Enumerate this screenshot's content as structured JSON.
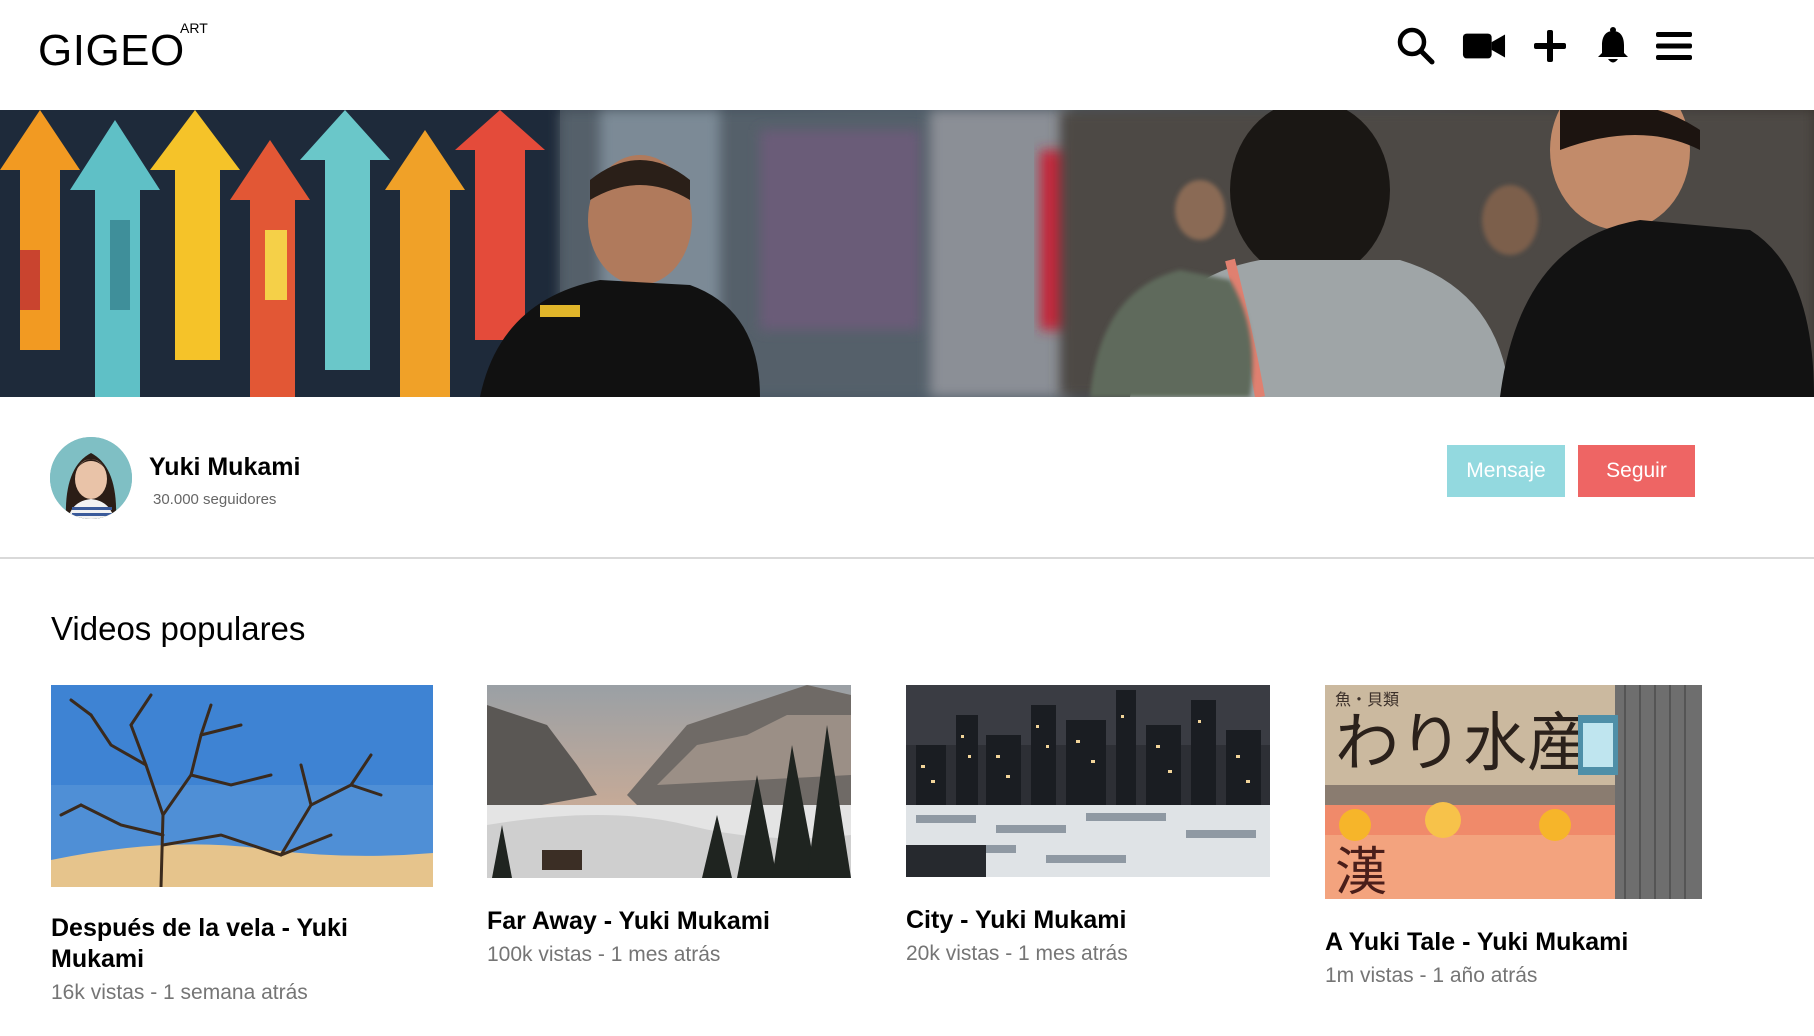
{
  "header": {
    "logo": "GIGEO",
    "logo_sup": "ART",
    "icons": [
      "search-icon",
      "video-camera-icon",
      "plus-icon",
      "bell-icon",
      "menu-icon"
    ]
  },
  "profile": {
    "name": "Yuki Mukami",
    "followers": "30.000 seguidores",
    "message_label": "Mensaje",
    "follow_label": "Seguir"
  },
  "section": {
    "title": "Videos populares"
  },
  "videos": [
    {
      "title": "Después de la vela - Yuki Mukami",
      "meta": "16k vistas - 1 semana atrás"
    },
    {
      "title": "Far Away - Yuki Mukami",
      "meta": "100k vistas - 1 mes atrás"
    },
    {
      "title": "City - Yuki Mukami",
      "meta": "20k vistas - 1 mes atrás"
    },
    {
      "title": "A Yuki Tale - Yuki Mukami",
      "meta": "1m vistas - 1 año atrás"
    }
  ],
  "colors": {
    "message_button": "#93d9df",
    "follow_button": "#ee6564",
    "meta_text": "#757575"
  }
}
